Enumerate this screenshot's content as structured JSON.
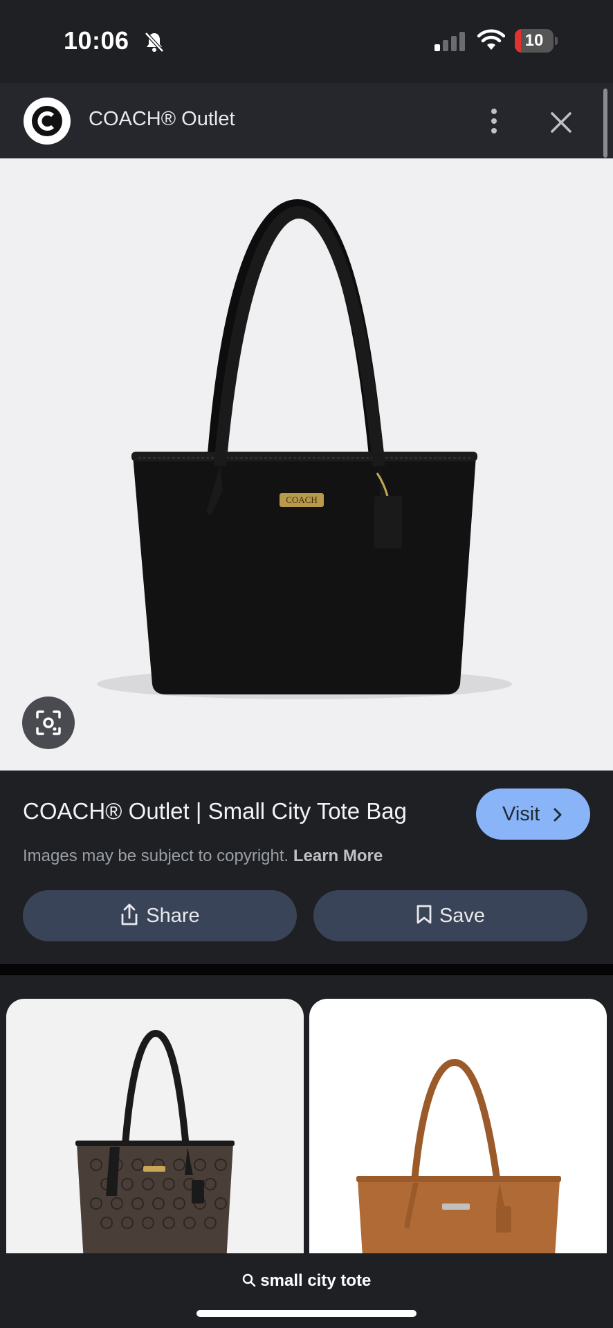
{
  "status_bar": {
    "time": "10:06",
    "battery_level": "10",
    "battery_fraction": 0.1,
    "icons": [
      "bell-muted-icon",
      "signal-icon",
      "wifi-icon",
      "battery-icon"
    ]
  },
  "header": {
    "site_name": "COACH® Outlet",
    "logo_letter": "C",
    "icons": [
      "more-vertical-icon",
      "close-icon"
    ]
  },
  "hero": {
    "lens_icon": "google-lens-icon",
    "bag_color": "#121212",
    "background": "#f0f0f2"
  },
  "result": {
    "title": "COACH® Outlet | Small City Tote Bag",
    "visit_label": "Visit",
    "copyright_text": "Images may be subject to copyright.",
    "learn_more": "Learn More",
    "share_label": "Share",
    "save_label": "Save",
    "accent": "#8ab4f8"
  },
  "related": {
    "items": [
      {
        "bag": "signature-canvas-tote",
        "bag_color": "#4a3f38",
        "background": "#f2f2f2"
      },
      {
        "bag": "tan-leather-tote",
        "bag_color": "#b06a36",
        "background": "#ffffff"
      }
    ]
  },
  "bottom": {
    "query": "small city tote"
  }
}
